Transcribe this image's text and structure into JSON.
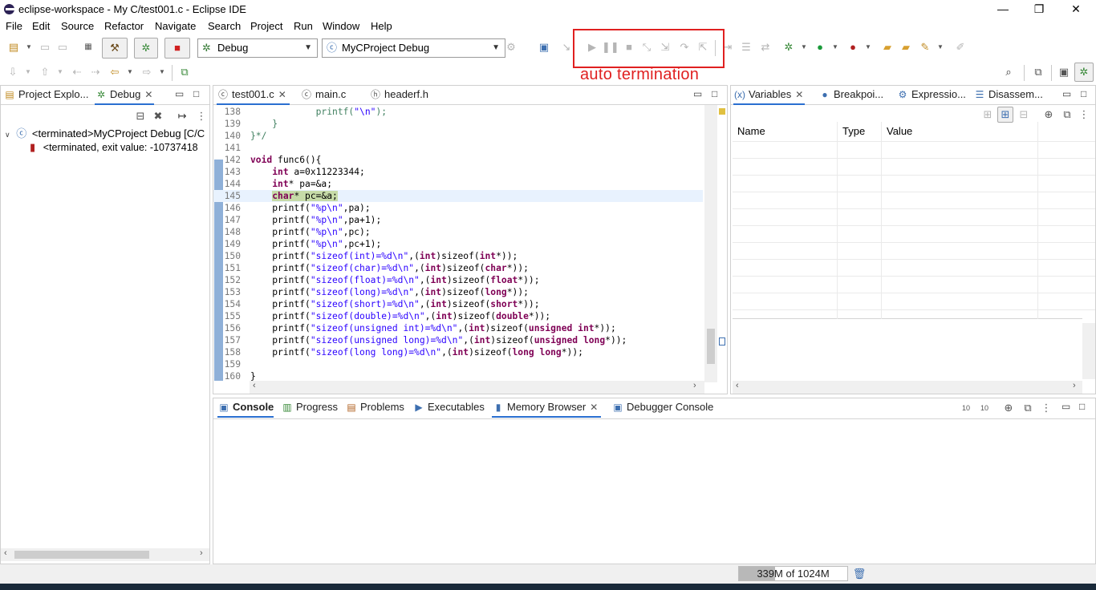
{
  "window": {
    "title": "eclipse-workspace - My C/test001.c - Eclipse IDE",
    "minimize": "—",
    "maximize": "❐",
    "close": "✕"
  },
  "menu": [
    {
      "label": "File"
    },
    {
      "label": "Edit"
    },
    {
      "label": "Source"
    },
    {
      "label": "Refactor"
    },
    {
      "label": "Navigate"
    },
    {
      "label": "Search"
    },
    {
      "label": "Project"
    },
    {
      "label": "Run"
    },
    {
      "label": "Window"
    },
    {
      "label": "Help"
    }
  ],
  "toolbar": {
    "launch_mode": "Debug",
    "launch_config": "MyCProject Debug",
    "annotation": "auto termination"
  },
  "debug_view": {
    "tabs": [
      {
        "label": "Project Explo...",
        "icon": "project-explorer-icon"
      },
      {
        "label": "Debug",
        "icon": "bug-icon"
      }
    ],
    "tree": [
      {
        "label": "<terminated>MyCProject Debug [C/C"
      },
      {
        "label": "<terminated, exit value: -10737418"
      }
    ]
  },
  "editor": {
    "tabs": [
      {
        "label": "test001.c"
      },
      {
        "label": "main.c"
      },
      {
        "label": "headerf.h"
      }
    ],
    "current_line": 145,
    "lines": [
      {
        "n": "138",
        "code": "            printf(\"\\n\");"
      },
      {
        "n": "139",
        "code": "    }"
      },
      {
        "n": "140",
        "code": "}*/"
      },
      {
        "n": "141",
        "code": ""
      },
      {
        "n": "142",
        "code": "void func6(){"
      },
      {
        "n": "143",
        "code": "    int a=0x11223344;"
      },
      {
        "n": "144",
        "code": "    int* pa=&a;"
      },
      {
        "n": "145",
        "code": "    char* pc=&a;"
      },
      {
        "n": "146",
        "code": "    printf(\"%p\\n\",pa);"
      },
      {
        "n": "147",
        "code": "    printf(\"%p\\n\",pa+1);"
      },
      {
        "n": "148",
        "code": "    printf(\"%p\\n\",pc);"
      },
      {
        "n": "149",
        "code": "    printf(\"%p\\n\",pc+1);"
      },
      {
        "n": "150",
        "code": "    printf(\"sizeof(int)=%d\\n\",(int)sizeof(int*));"
      },
      {
        "n": "151",
        "code": "    printf(\"sizeof(char)=%d\\n\",(int)sizeof(char*));"
      },
      {
        "n": "152",
        "code": "    printf(\"sizeof(float)=%d\\n\",(int)sizeof(float*));"
      },
      {
        "n": "153",
        "code": "    printf(\"sizeof(long)=%d\\n\",(int)sizeof(long*));"
      },
      {
        "n": "154",
        "code": "    printf(\"sizeof(short)=%d\\n\",(int)sizeof(short*));"
      },
      {
        "n": "155",
        "code": "    printf(\"sizeof(double)=%d\\n\",(int)sizeof(double*));"
      },
      {
        "n": "156",
        "code": "    printf(\"sizeof(unsigned int)=%d\\n\",(int)sizeof(unsigned int*));"
      },
      {
        "n": "157",
        "code": "    printf(\"sizeof(unsigned long)=%d\\n\",(int)sizeof(unsigned long*));"
      },
      {
        "n": "158",
        "code": "    printf(\"sizeof(long long)=%d\\n\",(int)sizeof(long long*));"
      },
      {
        "n": "159",
        "code": ""
      },
      {
        "n": "160",
        "code": "}"
      }
    ]
  },
  "variables_view": {
    "tabs": [
      {
        "label": "Variables"
      },
      {
        "label": "Breakpoi..."
      },
      {
        "label": "Expressio..."
      },
      {
        "label": "Disassem..."
      }
    ],
    "columns": [
      "Name",
      "Type",
      "Value"
    ]
  },
  "bottom_view": {
    "tabs": [
      {
        "label": "Console"
      },
      {
        "label": "Progress"
      },
      {
        "label": "Problems"
      },
      {
        "label": "Executables"
      },
      {
        "label": "Memory Browser"
      },
      {
        "label": "Debugger Console"
      }
    ]
  },
  "status": {
    "heap": "339M of 1024M",
    "heap_used_fraction": 0.331
  }
}
